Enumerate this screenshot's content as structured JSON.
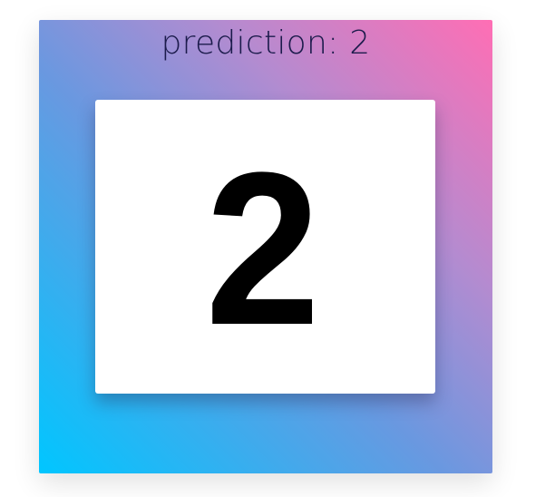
{
  "prediction": {
    "label": "prediction: 2"
  },
  "canvas": {
    "drawn_digit": "2"
  },
  "colors": {
    "gradient_start": "#00c6ff",
    "gradient_end": "#ff6eb4",
    "prediction_text": "#1b1b4b",
    "canvas_bg": "#ffffff",
    "digit": "#000000"
  }
}
